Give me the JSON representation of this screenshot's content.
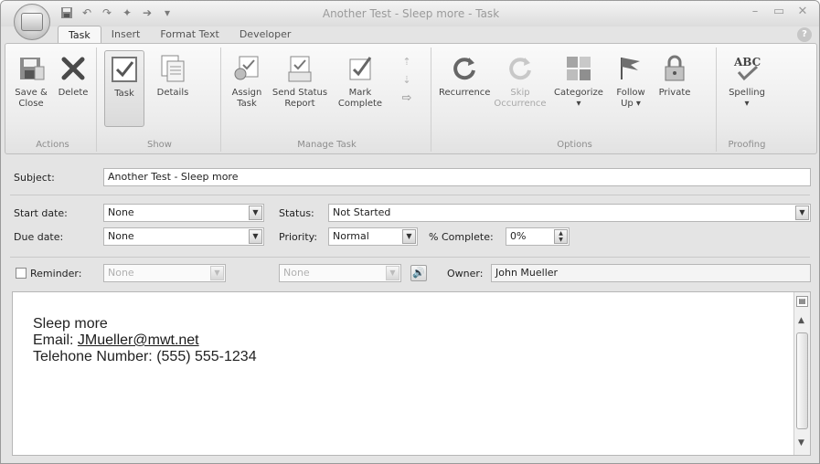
{
  "window": {
    "title": "Another Test - Sleep more - Task"
  },
  "qat": {
    "icons": [
      "save-icon",
      "undo-icon",
      "redo-icon",
      "up-arrow-icon",
      "down-arrow-icon",
      "customize-icon"
    ]
  },
  "tabs": [
    {
      "label": "Task"
    },
    {
      "label": "Insert"
    },
    {
      "label": "Format Text"
    },
    {
      "label": "Developer"
    }
  ],
  "ribbon": {
    "groups": {
      "actions": "Actions",
      "show": "Show",
      "manage": "Manage Task",
      "options": "Options",
      "proofing": "Proofing"
    },
    "buttons": {
      "save_close": "Save &\nClose",
      "delete": "Delete",
      "task": "Task",
      "details": "Details",
      "assign_task": "Assign\nTask",
      "send_status": "Send Status\nReport",
      "mark_complete": "Mark\nComplete",
      "recurrence": "Recurrence",
      "skip_occurrence": "Skip\nOccurrence",
      "categorize": "Categorize\n▾",
      "follow_up": "Follow\nUp ▾",
      "private": "Private",
      "spelling": "Spelling\n▾"
    }
  },
  "form": {
    "subject_label": "Subject:",
    "subject_value": "Another Test - Sleep more",
    "start_label": "Start date:",
    "start_value": "None",
    "due_label": "Due date:",
    "due_value": "None",
    "status_label": "Status:",
    "status_value": "Not Started",
    "priority_label": "Priority:",
    "priority_value": "Normal",
    "complete_label": "% Complete:",
    "complete_value": "0%",
    "reminder_label": "Reminder:",
    "reminder_date": "None",
    "reminder_time": "None",
    "owner_label": "Owner:",
    "owner_value": "John Mueller"
  },
  "body": {
    "line1": "Sleep more",
    "line2_prefix": "Email: ",
    "email": "JMueller@mwt.net",
    "line3": "Telehone Number: (555) 555-1234"
  }
}
